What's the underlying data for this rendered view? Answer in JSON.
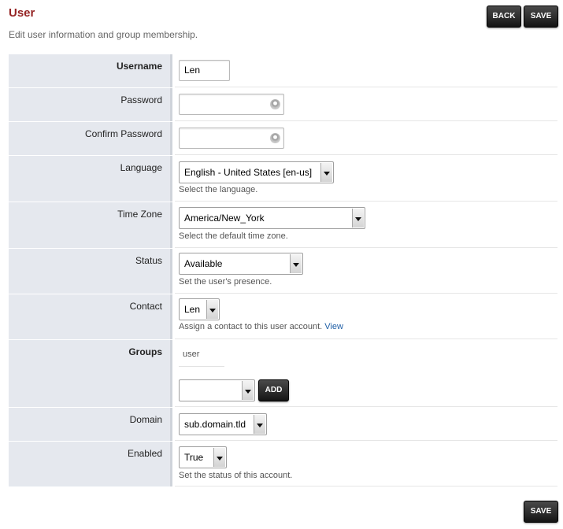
{
  "header": {
    "title": "User",
    "description": "Edit user information and group membership.",
    "back_label": "BACK",
    "save_label": "SAVE"
  },
  "form": {
    "username": {
      "label": "Username",
      "value": "Len"
    },
    "password": {
      "label": "Password",
      "value": ""
    },
    "confirm_password": {
      "label": "Confirm Password",
      "value": ""
    },
    "language": {
      "label": "Language",
      "selected": "English - United States [en-us]",
      "hint": "Select the language."
    },
    "time_zone": {
      "label": "Time Zone",
      "selected": "America/New_York",
      "hint": "Select the default time zone."
    },
    "status": {
      "label": "Status",
      "selected": "Available",
      "hint": "Set the user's presence."
    },
    "contact": {
      "label": "Contact",
      "selected": "Len",
      "hint": "Assign a contact to this user account.",
      "hint_link": "View"
    },
    "groups": {
      "label": "Groups",
      "members": [
        "user"
      ],
      "selected": "",
      "add_label": "ADD"
    },
    "domain": {
      "label": "Domain",
      "selected": "sub.domain.tld"
    },
    "enabled": {
      "label": "Enabled",
      "selected": "True",
      "hint": "Set the status of this account."
    }
  },
  "footer": {
    "save_label": "SAVE"
  },
  "colors": {
    "title": "#952424",
    "label_bg": "#e5e8ee",
    "button_bg": "#1e1e1e",
    "link": "#1f5fa6"
  },
  "icons": {
    "password_field": "password-reveal-icon"
  }
}
